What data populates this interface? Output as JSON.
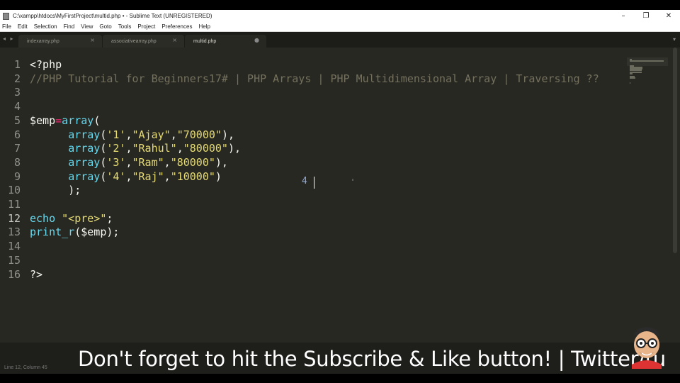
{
  "window": {
    "title": "C:\\xampp\\htdocs\\MyFirstProject\\multid.php • - Sublime Text (UNREGISTERED)",
    "controls": {
      "minimize": "–",
      "maximize": "❐",
      "close": "✕"
    }
  },
  "menu": [
    "File",
    "Edit",
    "Selection",
    "Find",
    "View",
    "Goto",
    "Tools",
    "Project",
    "Preferences",
    "Help"
  ],
  "tabs": [
    {
      "label": "indexarray.php",
      "close": "×"
    },
    {
      "label": "associativearray.php",
      "close": "×"
    },
    {
      "label": "multid.php",
      "close": "●"
    }
  ],
  "tab_nav": "◂ ▸",
  "tab_dropdown": "▾",
  "editor": {
    "current_line": 12,
    "lines": [
      {
        "n": "1",
        "tokens": [
          {
            "t": "<?php",
            "c": "plain"
          }
        ]
      },
      {
        "n": "2",
        "tokens": [
          {
            "t": "//PHP Tutorial for Beginners17# | PHP Arrays | PHP Multidimensional Array | Traversing ??",
            "c": "comment"
          }
        ]
      },
      {
        "n": "3",
        "tokens": []
      },
      {
        "n": "4",
        "tokens": []
      },
      {
        "n": "5",
        "tokens": [
          {
            "t": "$emp",
            "c": "var"
          },
          {
            "t": "=",
            "c": "op"
          },
          {
            "t": "array",
            "c": "fn"
          },
          {
            "t": "(",
            "c": "punc"
          }
        ]
      },
      {
        "n": "6",
        "tokens": [
          {
            "t": "      ",
            "c": "plain"
          },
          {
            "t": "array",
            "c": "fn"
          },
          {
            "t": "(",
            "c": "punc"
          },
          {
            "t": "'1'",
            "c": "str"
          },
          {
            "t": ",",
            "c": "punc"
          },
          {
            "t": "\"Ajay\"",
            "c": "str"
          },
          {
            "t": ",",
            "c": "punc"
          },
          {
            "t": "\"70000\"",
            "c": "str"
          },
          {
            "t": "),",
            "c": "punc"
          }
        ]
      },
      {
        "n": "7",
        "tokens": [
          {
            "t": "      ",
            "c": "plain"
          },
          {
            "t": "array",
            "c": "fn"
          },
          {
            "t": "(",
            "c": "punc"
          },
          {
            "t": "'2'",
            "c": "str"
          },
          {
            "t": ",",
            "c": "punc"
          },
          {
            "t": "\"Rahul\"",
            "c": "str"
          },
          {
            "t": ",",
            "c": "punc"
          },
          {
            "t": "\"80000\"",
            "c": "str"
          },
          {
            "t": "),",
            "c": "punc"
          }
        ]
      },
      {
        "n": "8",
        "tokens": [
          {
            "t": "      ",
            "c": "plain"
          },
          {
            "t": "array",
            "c": "fn"
          },
          {
            "t": "(",
            "c": "punc"
          },
          {
            "t": "'3'",
            "c": "str"
          },
          {
            "t": ",",
            "c": "punc"
          },
          {
            "t": "\"Ram\"",
            "c": "str"
          },
          {
            "t": ",",
            "c": "punc"
          },
          {
            "t": "\"80000\"",
            "c": "str"
          },
          {
            "t": "),",
            "c": "punc"
          }
        ]
      },
      {
        "n": "9",
        "tokens": [
          {
            "t": "      ",
            "c": "plain"
          },
          {
            "t": "array",
            "c": "fn"
          },
          {
            "t": "(",
            "c": "punc"
          },
          {
            "t": "'4'",
            "c": "str"
          },
          {
            "t": ",",
            "c": "punc"
          },
          {
            "t": "\"Raj\"",
            "c": "str"
          },
          {
            "t": ",",
            "c": "punc"
          },
          {
            "t": "\"10000\"",
            "c": "str"
          },
          {
            "t": ")",
            "c": "punc"
          }
        ]
      },
      {
        "n": "10",
        "tokens": [
          {
            "t": "      ",
            "c": "plain"
          },
          {
            "t": ");",
            "c": "punc"
          }
        ]
      },
      {
        "n": "11",
        "tokens": []
      },
      {
        "n": "12",
        "tokens": [
          {
            "t": "echo",
            "c": "fn"
          },
          {
            "t": " ",
            "c": "plain"
          },
          {
            "t": "\"<pre>\"",
            "c": "str"
          },
          {
            "t": ";",
            "c": "punc"
          }
        ]
      },
      {
        "n": "13",
        "tokens": [
          {
            "t": "print_r",
            "c": "fn"
          },
          {
            "t": "(",
            "c": "punc"
          },
          {
            "t": "$emp",
            "c": "var"
          },
          {
            "t": ");",
            "c": "punc"
          }
        ]
      },
      {
        "n": "14",
        "tokens": []
      },
      {
        "n": "15",
        "tokens": []
      },
      {
        "n": "16",
        "tokens": [
          {
            "t": "?>",
            "c": "plain"
          }
        ]
      }
    ],
    "column_indicator": "4"
  },
  "status": {
    "text": "Line 12, Column 45"
  },
  "overlay": {
    "subtitle": "Don't forget to hit the Subscribe & Like button! | Twitter/tu"
  },
  "colors": {
    "background": "#272822",
    "comment": "#75715e",
    "keyword": "#66d9ef",
    "string": "#e6db74",
    "operator": "#f92672"
  }
}
